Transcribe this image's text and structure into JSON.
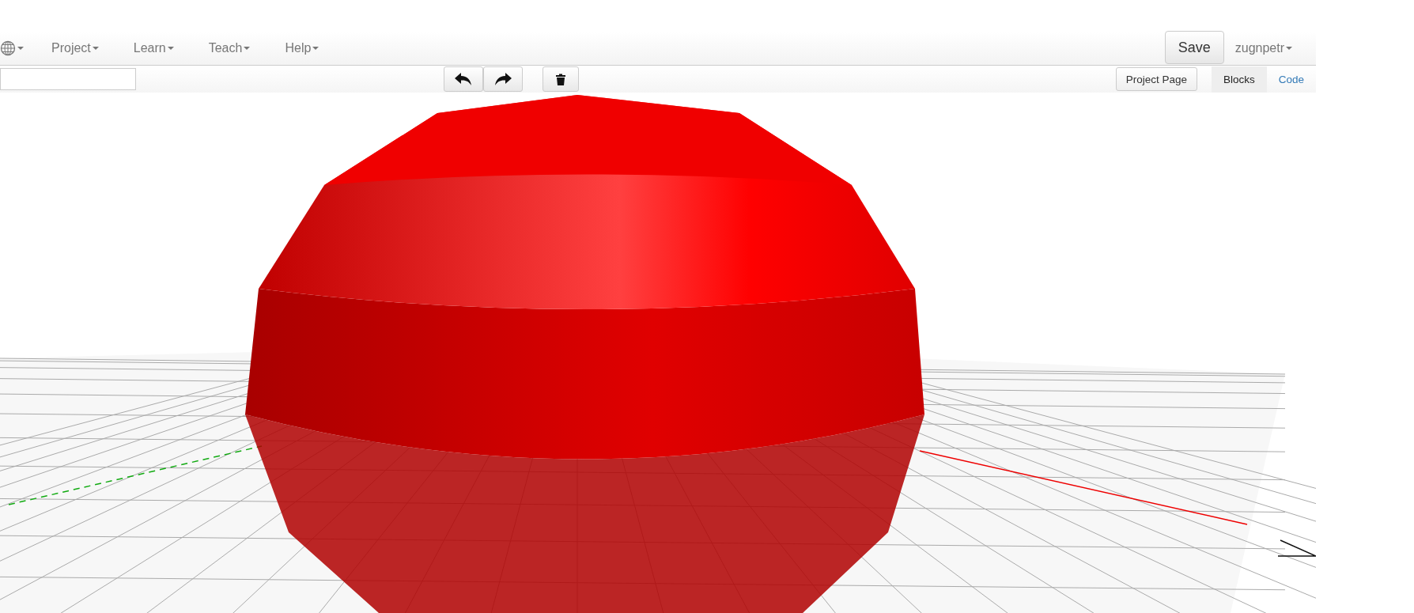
{
  "navbar": {
    "menus": [
      {
        "label": "Project"
      },
      {
        "label": "Learn"
      },
      {
        "label": "Teach"
      },
      {
        "label": "Help"
      }
    ],
    "save": "Save",
    "user": "zugnpetr"
  },
  "toolbar": {
    "project_page": "Project Page",
    "tabs": [
      {
        "label": "Blocks",
        "selected": true
      },
      {
        "label": "Code",
        "selected": false
      }
    ]
  }
}
